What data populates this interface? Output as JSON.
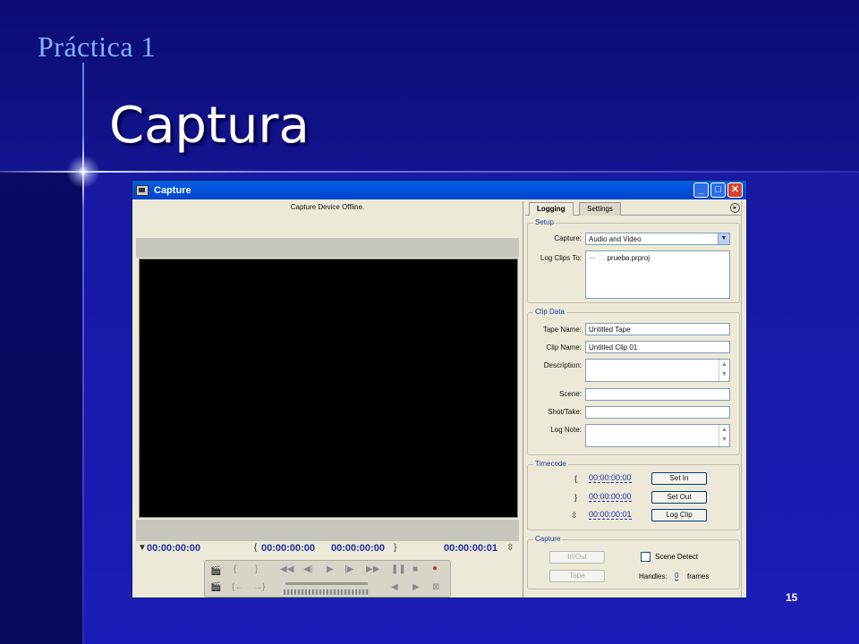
{
  "slide": {
    "kicker": "Práctica 1",
    "title": "Captura",
    "page_number": "15"
  },
  "window": {
    "title": "Capture",
    "buttons": {
      "minimize": "_",
      "maximize": "□",
      "close": "✕"
    }
  },
  "monitor": {
    "status": "Capture Device Offline.",
    "timecodes": {
      "current": "00:00:00:00",
      "in": "00:00:00:00",
      "out": "00:00:00:00",
      "duration": "00:00:00:01"
    }
  },
  "panel": {
    "tabs": [
      {
        "label": "Logging",
        "active": true
      },
      {
        "label": "Settings",
        "active": false
      }
    ],
    "setup": {
      "group_label": "Setup",
      "capture_label": "Capture:",
      "capture_value": "Audio and Video",
      "log_clips_label": "Log Clips To:",
      "project_file": "prueba.prproj"
    },
    "clip_data": {
      "group_label": "Clip Data",
      "tape_name_label": "Tape Name:",
      "tape_name_value": "Untitled Tape",
      "clip_name_label": "Clip Name:",
      "clip_name_value": "Untitled Clip 01",
      "description_label": "Description:",
      "scene_label": "Scene:",
      "shot_take_label": "Shot/Take:",
      "log_note_label": "Log Note:"
    },
    "timecode": {
      "group_label": "Timecode",
      "in_value": "00:00:00:00",
      "out_value": "00:00:00:00",
      "duration_value": "00:00:00:01",
      "set_in_label": "Set In",
      "set_out_label": "Set Out",
      "log_clip_label": "Log Clip"
    },
    "capture": {
      "group_label": "Capture",
      "in_out_label": "In/Out",
      "tape_label": "Tape",
      "scene_detect_label": "Scene Detect",
      "handles_label": "Handles:",
      "handles_value": "0",
      "frames_label": "frames"
    }
  }
}
